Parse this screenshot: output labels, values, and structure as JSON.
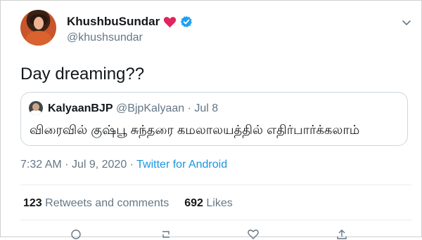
{
  "author": {
    "display_name": "KhushbuSundar",
    "handle": "@khushsundar"
  },
  "tweet": {
    "text": "Day dreaming??"
  },
  "quoted": {
    "display_name": "KalyaanBJP",
    "handle": "@BjpKalyaan",
    "separator": "·",
    "date": "Jul 8",
    "text": "விரைவில் குஷ்பூ சுந்தரை கமலாலயத்தில் எதிர்பார்க்கலாம்"
  },
  "meta": {
    "time": "7:32 AM",
    "separator1": "·",
    "date": "Jul 9, 2020",
    "separator2": "·",
    "source": "Twitter for Android"
  },
  "stats": {
    "retweets_count": "123",
    "retweets_label": "Retweets and comments",
    "likes_count": "692",
    "likes_label": "Likes"
  },
  "icons": {
    "heart": "heart-icon",
    "verified": "verified-badge-icon",
    "more": "chevron-down-icon"
  },
  "colors": {
    "link": "#1b95e0",
    "secondary_text": "#657786",
    "heart": "#e0245e",
    "verified": "#1da1f2"
  }
}
